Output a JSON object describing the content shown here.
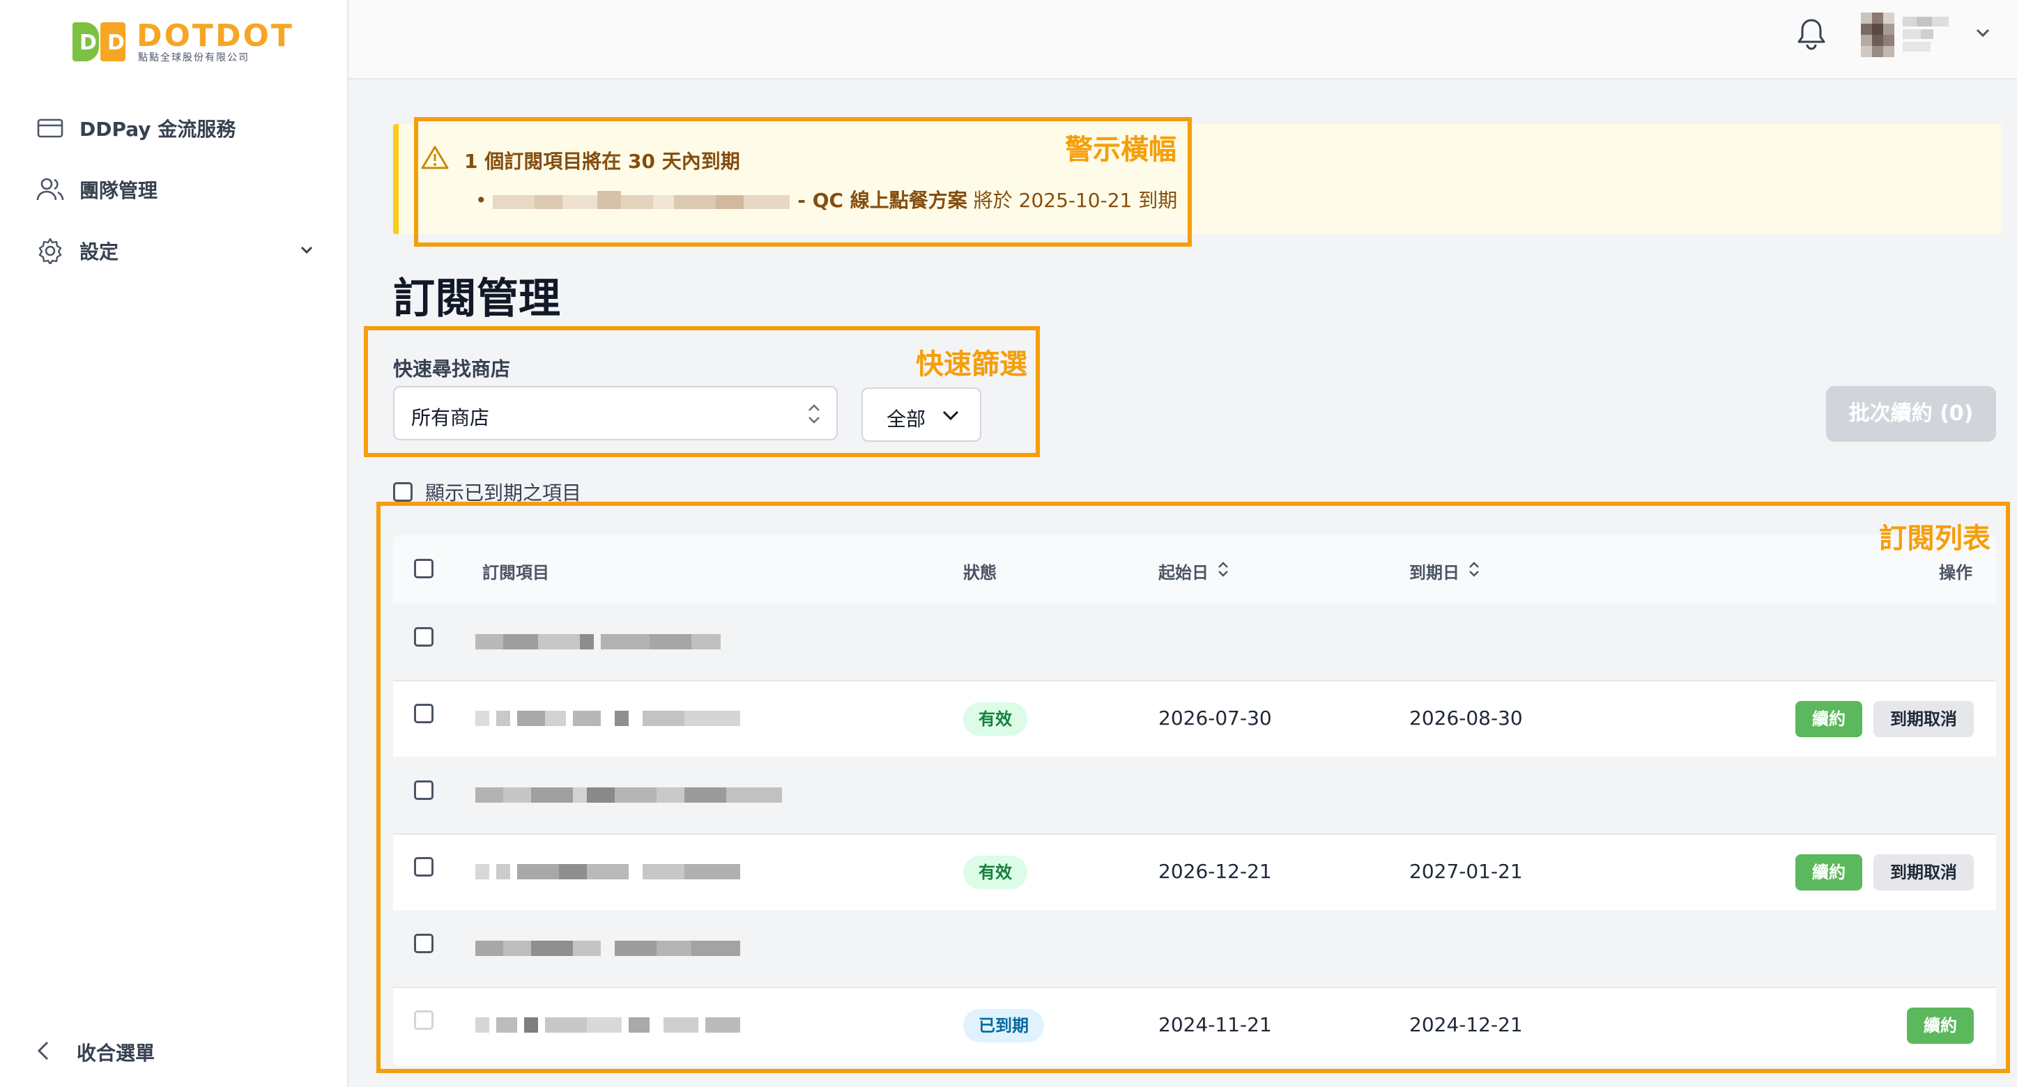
{
  "brand": {
    "name": "DOTDOT",
    "subtitle": "點點全球股份有限公司",
    "mark_left": "D",
    "mark_right": "D",
    "colors": {
      "green": "#7cc142",
      "orange": "#f6a623"
    }
  },
  "sidebar": {
    "items": [
      {
        "label": "DDPay 金流服務",
        "icon": "credit-card-icon"
      },
      {
        "label": "團隊管理",
        "icon": "users-icon"
      },
      {
        "label": "設定",
        "icon": "gear-icon"
      }
    ],
    "collapse_label": "收合選單"
  },
  "header": {
    "notification_icon": "bell-icon"
  },
  "banner": {
    "title": "1 個訂閱項目將在 30 天內到期",
    "item_plan": " - QC 線上點餐方案",
    "item_suffix_prefix": " 將於 ",
    "item_date": "2025-10-21",
    "item_suffix": " 到期"
  },
  "annotations": {
    "banner": "警示橫幅",
    "filter": "快速篩選",
    "list": "訂閱列表",
    "color": "#f59e0b"
  },
  "page": {
    "title": "訂閱管理"
  },
  "filter": {
    "label": "快速尋找商店",
    "store_value": "所有商店",
    "scope_value": "全部",
    "batch_label": "批次續約 (0)",
    "show_expired_label": "顯示已到期之項目"
  },
  "table": {
    "headers": {
      "item": "訂閱項目",
      "status": "狀態",
      "start": "起始日",
      "end": "到期日",
      "actions": "操作"
    },
    "rows": [
      {
        "status": "",
        "start": "",
        "end": ""
      },
      {
        "status": "有效",
        "start": "2026-07-30",
        "end": "2026-08-30",
        "renew": "續約",
        "cancel": "到期取消"
      },
      {
        "status": "",
        "start": "",
        "end": ""
      },
      {
        "status": "有效",
        "start": "2026-12-21",
        "end": "2027-01-21",
        "renew": "續約",
        "cancel": "到期取消"
      },
      {
        "status": "",
        "start": "",
        "end": ""
      },
      {
        "status": "已到期",
        "start": "2024-11-21",
        "end": "2024-12-21",
        "renew": "續約"
      }
    ]
  }
}
